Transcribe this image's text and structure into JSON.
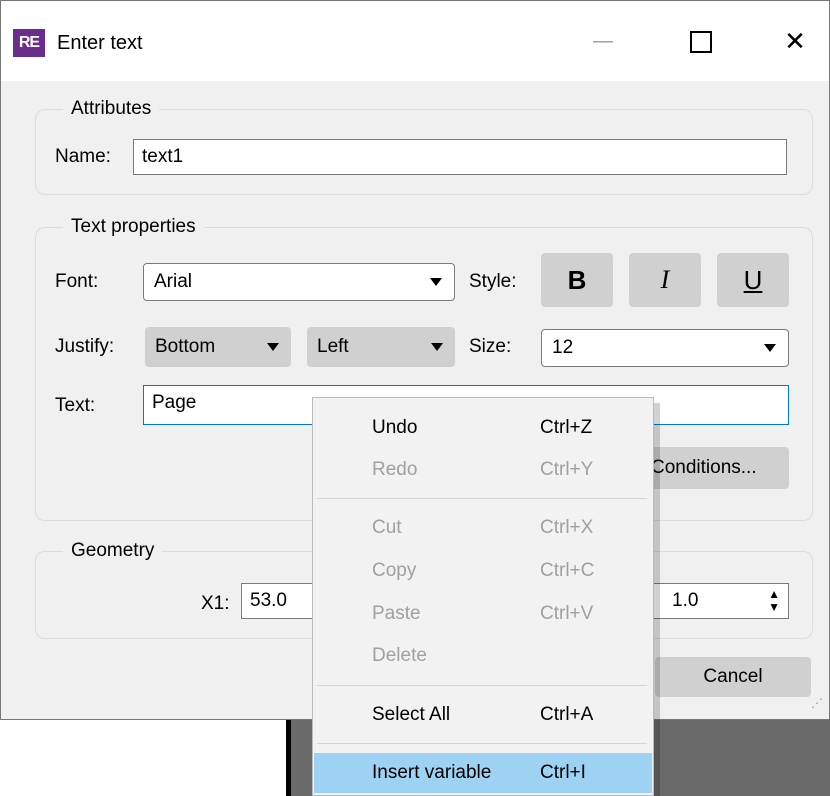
{
  "window": {
    "title": "Enter text",
    "app_icon_text": "RE"
  },
  "attributes": {
    "group_title": "Attributes",
    "name_label": "Name:",
    "name_value": "text1"
  },
  "text_properties": {
    "group_title": "Text properties",
    "font_label": "Font:",
    "font_value": "Arial",
    "style_label": "Style:",
    "bold": "B",
    "italic": "I",
    "underline": "U",
    "justify_label": "Justify:",
    "justify_vertical": "Bottom",
    "justify_horizontal": "Left",
    "size_label": "Size:",
    "size_value": "12",
    "text_label": "Text:",
    "text_value": "Page",
    "conditions_button": "Conditions..."
  },
  "geometry": {
    "group_title": "Geometry",
    "x1_label": "X1:",
    "x1_value": "53.0",
    "other_value": "1.0"
  },
  "buttons": {
    "cancel": "Cancel"
  },
  "context_menu": {
    "undo": {
      "label": "Undo",
      "shortcut": "Ctrl+Z"
    },
    "redo": {
      "label": "Redo",
      "shortcut": "Ctrl+Y"
    },
    "cut": {
      "label": "Cut",
      "shortcut": "Ctrl+X"
    },
    "copy": {
      "label": "Copy",
      "shortcut": "Ctrl+C"
    },
    "paste": {
      "label": "Paste",
      "shortcut": "Ctrl+V"
    },
    "delete": {
      "label": "Delete"
    },
    "select_all": {
      "label": "Select All",
      "shortcut": "Ctrl+A"
    },
    "insert_variable": {
      "label": "Insert variable",
      "shortcut": "Ctrl+I"
    }
  },
  "colors": {
    "accent": "#0078d7",
    "menu_highlight": "#9dd2f2",
    "app_icon": "#6b2d8b"
  }
}
